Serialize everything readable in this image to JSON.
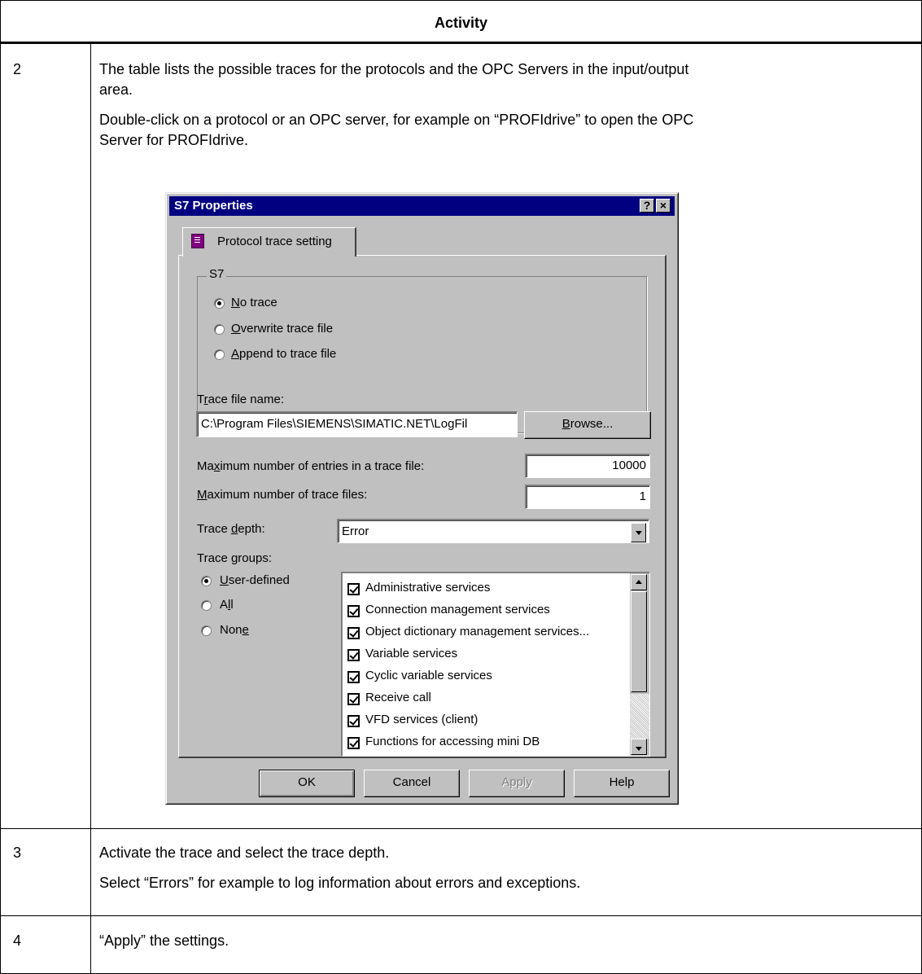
{
  "table": {
    "header": "Activity",
    "rows": [
      {
        "number": "2",
        "lines": [
          "The table lists the possible traces for the protocols and the OPC Servers in the input/output",
          "area.",
          "Double-click on a protocol or an OPC server, for example on “PROFIdrive” to open the OPC",
          "Server for PROFIdrive."
        ]
      },
      {
        "number": "3",
        "lines": [
          "Activate the trace and select the trace depth.",
          "Select “Errors” for example to log information about errors and exceptions."
        ]
      },
      {
        "number": "4",
        "lines": [
          "“Apply” the settings."
        ]
      }
    ]
  },
  "dialog": {
    "title": "S7 Properties",
    "help_button": "?",
    "close_button": "×",
    "tab_label": "Protocol trace setting",
    "group": {
      "label": "S7",
      "options": [
        {
          "pre": "",
          "key": "N",
          "post": "o trace",
          "selected": true
        },
        {
          "pre": "",
          "key": "O",
          "post": "verwrite trace file",
          "selected": false
        },
        {
          "pre": "",
          "key": "A",
          "post": "ppend to trace file",
          "selected": false
        }
      ]
    },
    "trace_file": {
      "label_pre": "T",
      "label_key": "r",
      "label_post": "ace file name:",
      "value": "C:\\Program Files\\SIEMENS\\SIMATIC.NET\\LogFil",
      "browse_pre": "",
      "browse_key": "B",
      "browse_post": "rowse..."
    },
    "max_entries": {
      "label_pre": "Ma",
      "label_key": "x",
      "label_post": "imum number of entries in a trace file:",
      "value": "10000"
    },
    "max_files": {
      "label_pre": "",
      "label_key": "M",
      "label_post": "aximum number of trace files:",
      "value": "1"
    },
    "trace_depth": {
      "label_pre": "Trace ",
      "label_key": "d",
      "label_post": "epth:",
      "value": "Error"
    },
    "trace_groups": {
      "label_pre": "Trace ",
      "label_key": "g",
      "label_post": "roups:",
      "options": [
        {
          "pre": "",
          "key": "U",
          "post": "ser-defined",
          "selected": true
        },
        {
          "pre": "A",
          "key": "l",
          "post": "l",
          "selected": false
        },
        {
          "pre": "Non",
          "key": "e",
          "post": "",
          "selected": false
        }
      ],
      "items": [
        {
          "label": "Administrative services",
          "checked": true
        },
        {
          "label": "Connection management services",
          "checked": true
        },
        {
          "label": "Object dictionary management services...",
          "checked": true
        },
        {
          "label": "Variable services",
          "checked": true
        },
        {
          "label": "Cyclic variable services",
          "checked": true
        },
        {
          "label": "Receive call",
          "checked": true
        },
        {
          "label": "VFD services (client)",
          "checked": true
        },
        {
          "label": "Functions for accessing mini DB",
          "checked": true
        }
      ]
    },
    "buttons": {
      "ok": "OK",
      "cancel": "Cancel",
      "apply": "Apply",
      "help": "Help"
    }
  }
}
